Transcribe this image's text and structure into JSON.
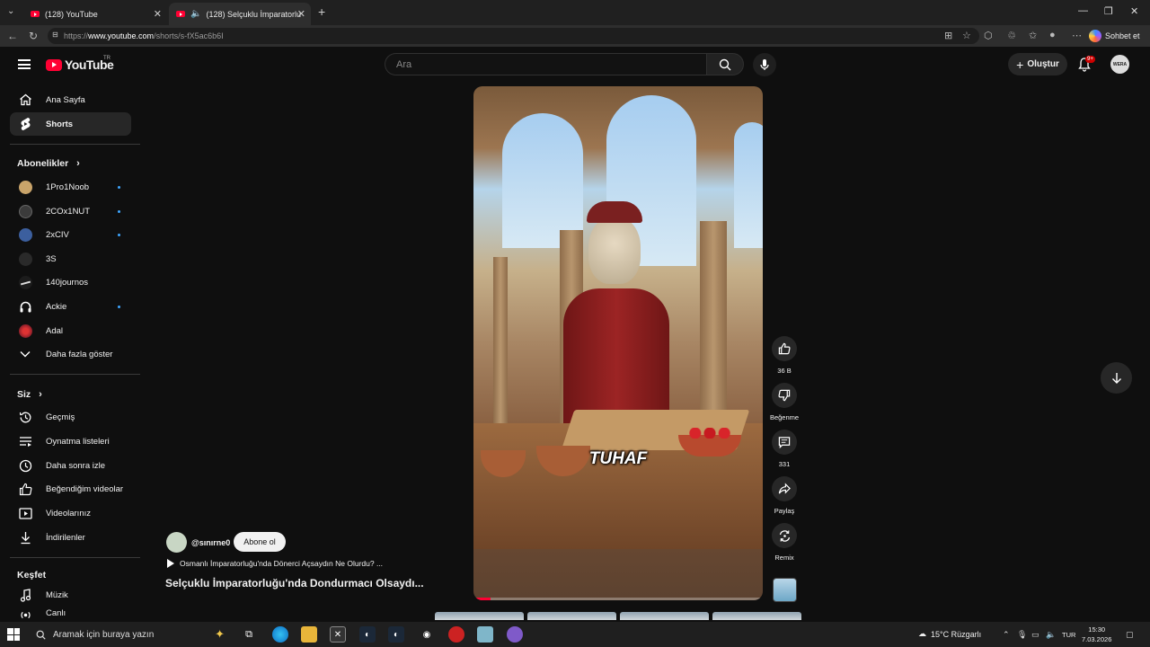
{
  "browser": {
    "tabs": [
      {
        "title": "(128) YouTube",
        "active": false
      },
      {
        "title": "(128) Selçuklu İmparatorluğu'",
        "active": true
      }
    ],
    "url_prefix": "https://",
    "url_host": "www.youtube.com",
    "url_path": "/shorts/s-fX5ac6b6I",
    "copilot_label": "Sohbet et"
  },
  "header": {
    "logo_text": "YouTube",
    "country_code": "TR",
    "search_placeholder": "Ara",
    "create_label": "Oluştur",
    "notifications_badge": "9+",
    "avatar_text": "WERA"
  },
  "sidebar": {
    "main": [
      {
        "label": "Ana Sayfa",
        "icon": "home-icon"
      },
      {
        "label": "Shorts",
        "icon": "shorts-icon",
        "active": true
      }
    ],
    "subscriptions_header": "Abonelikler",
    "subscriptions": [
      {
        "label": "1Pro1Noob",
        "new": true,
        "color": "#c9a46a"
      },
      {
        "label": "2COx1NUT",
        "new": true,
        "color": "#3b3b3b"
      },
      {
        "label": "2xCIV",
        "new": true,
        "color": "#3c5f9e"
      },
      {
        "label": "3S",
        "new": false,
        "color": "#2a2a2a"
      },
      {
        "label": "140journos",
        "new": false,
        "color": "#1c1c1c"
      },
      {
        "label": "Ackie",
        "new": true,
        "color": "#101010"
      },
      {
        "label": "Adal",
        "new": false,
        "color": "#8a1f2a"
      }
    ],
    "show_more": "Daha fazla göster",
    "you_header": "Siz",
    "you": [
      {
        "label": "Geçmiş",
        "icon": "history-icon"
      },
      {
        "label": "Oynatma listeleri",
        "icon": "playlists-icon"
      },
      {
        "label": "Daha sonra izle",
        "icon": "watch-later-icon"
      },
      {
        "label": "Beğendiğim videolar",
        "icon": "liked-icon"
      },
      {
        "label": "Videolarınız",
        "icon": "your-videos-icon"
      },
      {
        "label": "İndirilenler",
        "icon": "downloads-icon"
      }
    ],
    "explore_header": "Keşfet",
    "explore": [
      {
        "label": "Müzik",
        "icon": "music-icon"
      },
      {
        "label": "Canlı",
        "icon": "live-icon"
      }
    ]
  },
  "short": {
    "caption": "TUHAF",
    "progress": 0.06,
    "channel": "@sınırne0",
    "subscribe_label": "Abone ol",
    "series_title": "Osmanlı İmparatorluğu'nda Dönerci Açsaydın Ne Olurdu? ...",
    "title": "Selçuklu İmparatorluğu'nda Dondurmacı Olsaydı..."
  },
  "actions": {
    "like_count": "36 B",
    "dislike_label": "Beğenme",
    "comments_count": "331",
    "share_label": "Paylaş",
    "remix_label": "Remix"
  },
  "taskbar": {
    "search_placeholder": "Aramak için buraya yazın",
    "weather": "15°C  Rüzgarlı",
    "lang": "TUR",
    "time": "15:30",
    "date": "7.03.2026"
  }
}
